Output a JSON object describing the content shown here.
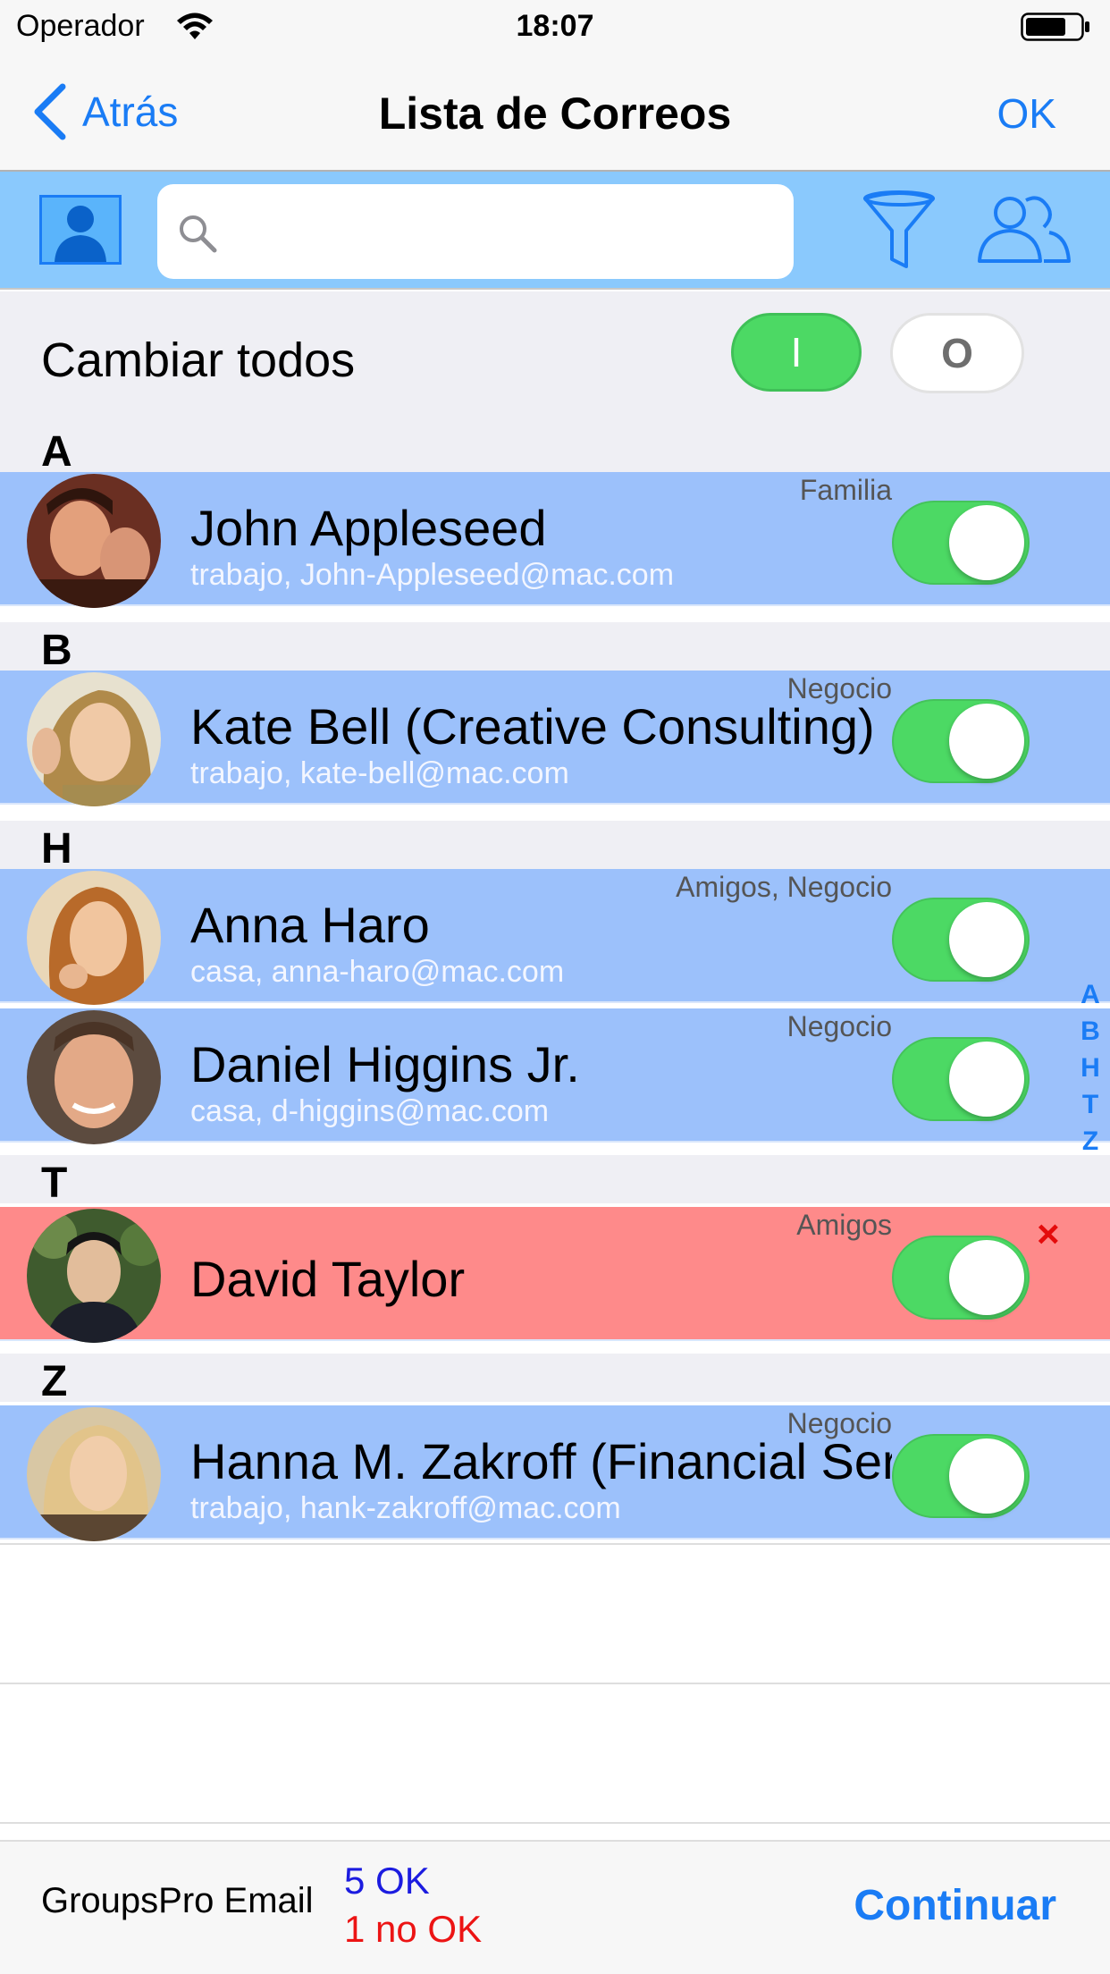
{
  "status_bar": {
    "carrier": "Operador",
    "time": "18:07"
  },
  "nav": {
    "back_label": "Atrás",
    "title": "Lista de Correos",
    "ok_label": "OK"
  },
  "toolbar": {
    "search_value": "",
    "search_placeholder": ""
  },
  "change_all": {
    "label": "Cambiar todos",
    "on_label": "I",
    "off_label": "O"
  },
  "sections": [
    {
      "letter": "A",
      "contacts": [
        {
          "name": "John Appleseed",
          "email": "trabajo, John-Appleseed@mac.com",
          "group": "Familia",
          "enabled": true,
          "error": false
        }
      ]
    },
    {
      "letter": "B",
      "contacts": [
        {
          "name": "Kate Bell (Creative Consulting)",
          "email": "trabajo, kate-bell@mac.com",
          "group": "Negocio",
          "enabled": true,
          "error": false
        }
      ]
    },
    {
      "letter": "H",
      "contacts": [
        {
          "name": "Anna Haro",
          "email": "casa, anna-haro@mac.com",
          "group": "Amigos, Negocio",
          "enabled": true,
          "error": false
        },
        {
          "name": "Daniel Higgins Jr.",
          "email": "casa, d-higgins@mac.com",
          "group": "Negocio",
          "enabled": true,
          "error": false
        }
      ]
    },
    {
      "letter": "T",
      "contacts": [
        {
          "name": "David Taylor",
          "email": "",
          "group": "Amigos",
          "enabled": true,
          "error": true,
          "error_mark": "×"
        }
      ]
    },
    {
      "letter": "Z",
      "contacts": [
        {
          "name": "Hanna M. Zakroff (Financial Services)",
          "email": "trabajo, hank-zakroff@mac.com",
          "group": "Negocio",
          "enabled": true,
          "error": false
        }
      ]
    }
  ],
  "index_letters": [
    "A",
    "B",
    "H",
    "T",
    "Z"
  ],
  "bottom_bar": {
    "app_name": "GroupsPro Email",
    "ok_count": "5 OK",
    "nok_count": "1 no OK",
    "continue_label": "Continuar"
  },
  "colors": {
    "accent": "#1a7cf5",
    "row_ok": "#9cc1fb",
    "row_error": "#fe8a8a",
    "toggle_on": "#4cd964",
    "toolbar_bg": "#8ac9fd"
  }
}
